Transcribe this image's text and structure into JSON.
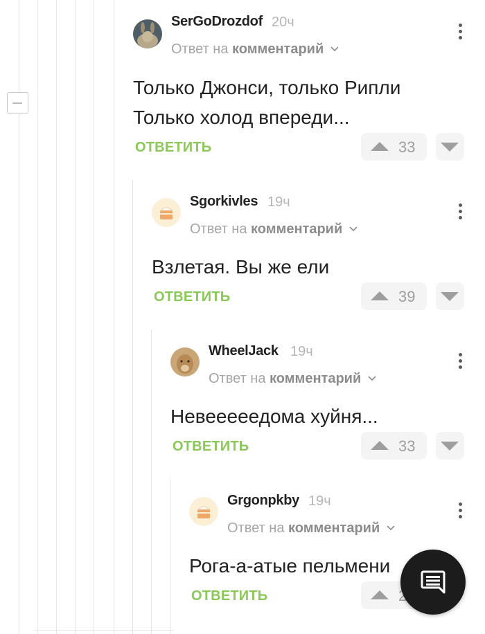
{
  "reply_to_prefix": "Ответ на",
  "reply_to_target": "комментарий",
  "reply_label": "ОТВЕТИТЬ",
  "comments": [
    {
      "username": "SerGoDrozdof",
      "time": "20ч",
      "text_lines": [
        "Только Джонси, только Рипли",
        "Только холод впереди..."
      ],
      "votes": "33",
      "avatar_icon": "hare-avatar-icon"
    },
    {
      "username": "Sgorkivles",
      "time": "19ч",
      "text_lines": [
        "Взлетая. Вы же ели"
      ],
      "votes": "39",
      "avatar_icon": "default-cake-avatar-icon"
    },
    {
      "username": "WheelJack",
      "time": "19ч",
      "text_lines": [
        "Невееееедома хуйня..."
      ],
      "votes": "33",
      "avatar_icon": "lioness-avatar-icon"
    },
    {
      "username": "Grgonpkby",
      "time": "19ч",
      "text_lines": [
        "Рога-а-атые пельмени"
      ],
      "votes": "2",
      "avatar_icon": "default-cake-avatar-icon"
    }
  ],
  "colors": {
    "reply_green": "#8ac858",
    "vote_gray": "#9e9e9e",
    "fab_bg": "#1c1c1c"
  },
  "fab_icon": "comment-icon"
}
